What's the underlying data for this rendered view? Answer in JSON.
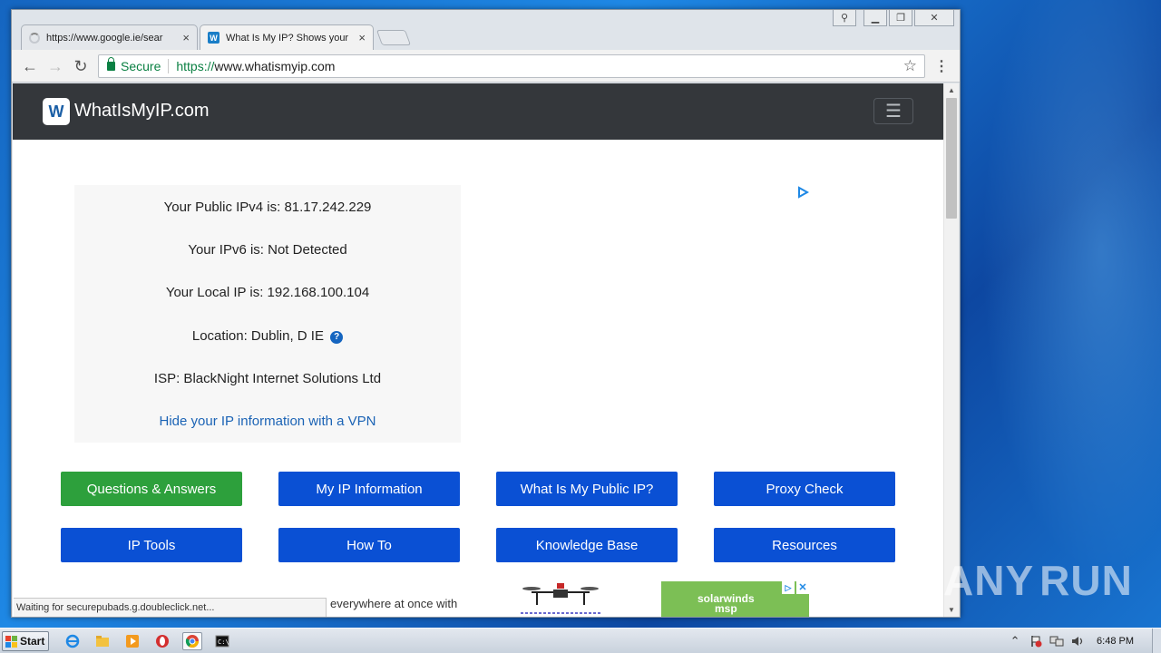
{
  "browser": {
    "tabs": [
      {
        "title": "https://www.google.ie/sear",
        "state": "loading"
      },
      {
        "title": "What Is My IP? Shows your",
        "state": "active"
      }
    ],
    "tab_close_glyph": "×",
    "window_controls": {
      "user": "⚲",
      "minimize": "▁",
      "restore": "❐",
      "close": "✕"
    },
    "nav": {
      "back": "←",
      "forward": "→",
      "reload": "↻"
    },
    "security_label": "Secure",
    "url_scheme": "https://",
    "url_host": "www.whatismyip.com",
    "bookmark_glyph": "☆",
    "menu_glyph": "⋮",
    "status_text": "Waiting for securepubads.g.doubleclick.net..."
  },
  "site": {
    "logo_letter": "W",
    "logo_text": "WhatIsMyIP.com",
    "menu_glyph": "☰",
    "ip_info": {
      "ipv4": "Your Public IPv4 is: 81.17.242.229",
      "ipv6": "Your IPv6 is: Not Detected",
      "local_ip": "Your Local IP is: 192.168.100.104",
      "location": "Location: Dublin, D IE",
      "location_help": "?",
      "isp": "ISP: BlackNight Internet Solutions Ltd",
      "vpn_link": "Hide your IP information with a VPN"
    },
    "nav_tiles": [
      "Questions & Answers",
      "My IP Information",
      "What Is My Public IP?",
      "Proxy Check",
      "IP Tools",
      "How To",
      "Knowledge Base",
      "Resources"
    ],
    "ad_strip_text": "everywhere at once with",
    "solarwinds_ad": {
      "line1": "solarwinds",
      "line2": "msp",
      "adchoice": "▷",
      "close": "✕"
    }
  },
  "watermark": {
    "left": "ANY",
    "right": "RUN"
  },
  "taskbar": {
    "start_label": "Start",
    "clock": "6:48 PM",
    "tray_arrow": "⌃"
  },
  "colors": {
    "tile_blue": "#0a50d4",
    "tile_green": "#2da03c",
    "site_nav": "#34373b",
    "secure_green": "#0b8043"
  }
}
